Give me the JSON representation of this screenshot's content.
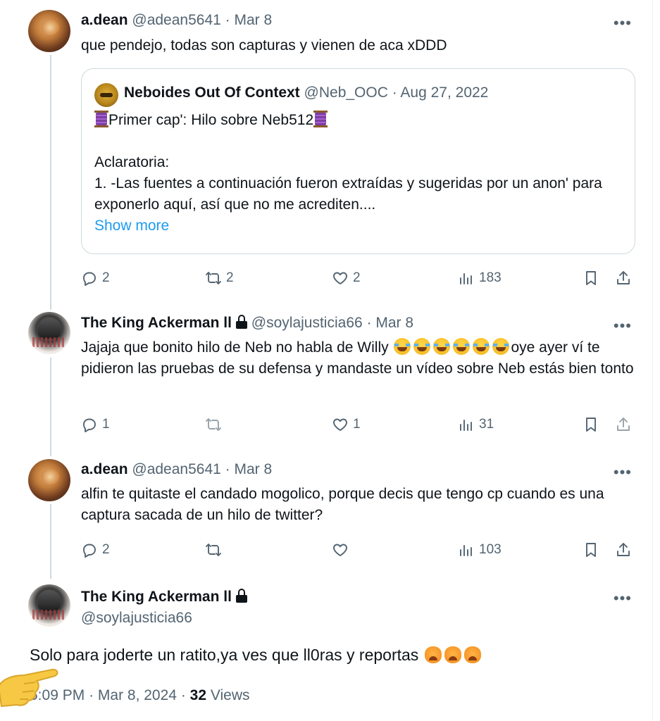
{
  "tweets": [
    {
      "name": "a.dean",
      "handle": "@adean5641",
      "sep": "·",
      "date": "Mar 8",
      "text": "que pendejo, todas son capturas y vienen de aca xDDD",
      "replies": "2",
      "retweets": "2",
      "likes": "2",
      "views": "183"
    },
    {
      "name": "The King Ackerman ll",
      "handle": "@soylajusticia66",
      "sep": "·",
      "date": "Mar 8",
      "text_a": "Jajaja que bonito hilo de Neb no habla de Willy ",
      "text_b": "oye ayer ví te pidieron las pruebas de su defensa y mandaste un vídeo sobre Neb estás bien tonto",
      "replies": "1",
      "retweets": "",
      "likes": "1",
      "views": "31"
    },
    {
      "name": "a.dean",
      "handle": "@adean5641",
      "sep": "·",
      "date": "Mar 8",
      "text": "alfin te quitaste el candado mogolico, porque decis que tengo cp cuando es una captura sacada de un hilo de twitter?",
      "replies": "2",
      "retweets": "",
      "likes": "",
      "views": "103"
    }
  ],
  "quote": {
    "name": "Neboides Out Of Context",
    "handle": "@Neb_OOC",
    "sep": "·",
    "date": "Aug 27, 2022",
    "line1": "Primer cap': Hilo sobre Neb512",
    "line2": "Aclaratoria:",
    "line3": "1. -Las fuentes a continuación fueron extraídas y sugeridas por un anon' para exponerlo aquí, así que no me acrediten....",
    "show_more": "Show more"
  },
  "main": {
    "name": "The King Ackerman ll",
    "handle": "@soylajusticia66",
    "text": "Solo para joderte un ratito,ya ves que ll0ras y reportas",
    "time": "5:09 PM",
    "sep1": "·",
    "date": "Mar 8, 2024",
    "sep2": "·",
    "views_count": "32",
    "views_label": "Views"
  },
  "more_label": "•••",
  "icons": [
    "reply-icon",
    "retweet-icon",
    "like-icon",
    "views-icon",
    "bookmark-icon",
    "share-icon",
    "lock-icon",
    "pointing-hand-emoji",
    "laughing-emoji",
    "crying-emoji",
    "spool-emoji"
  ],
  "colors": {
    "link": "#1d9bf0",
    "muted": "#536471",
    "text": "#0f1419",
    "border": "#cfd9de"
  }
}
